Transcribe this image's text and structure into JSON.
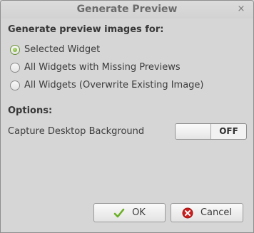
{
  "window": {
    "title": "Generate Preview",
    "close_glyph": "×"
  },
  "generate_heading": "Generate preview images for:",
  "radios": [
    {
      "label": "Selected Widget",
      "checked": true
    },
    {
      "label": "All Widgets with Missing Previews",
      "checked": false
    },
    {
      "label": "All Widgets (Overwrite Existing Image)",
      "checked": false
    }
  ],
  "options_heading": "Options:",
  "capture": {
    "label": "Capture Desktop Background",
    "state": "OFF"
  },
  "buttons": {
    "ok": {
      "label": "OK",
      "icon": "checkmark-icon"
    },
    "cancel": {
      "label": "Cancel",
      "icon": "cancel-icon"
    }
  },
  "colors": {
    "radio_selected": "#6fa52d",
    "ok_check": "#6ab023",
    "cancel_icon": "#cc1f1f"
  }
}
